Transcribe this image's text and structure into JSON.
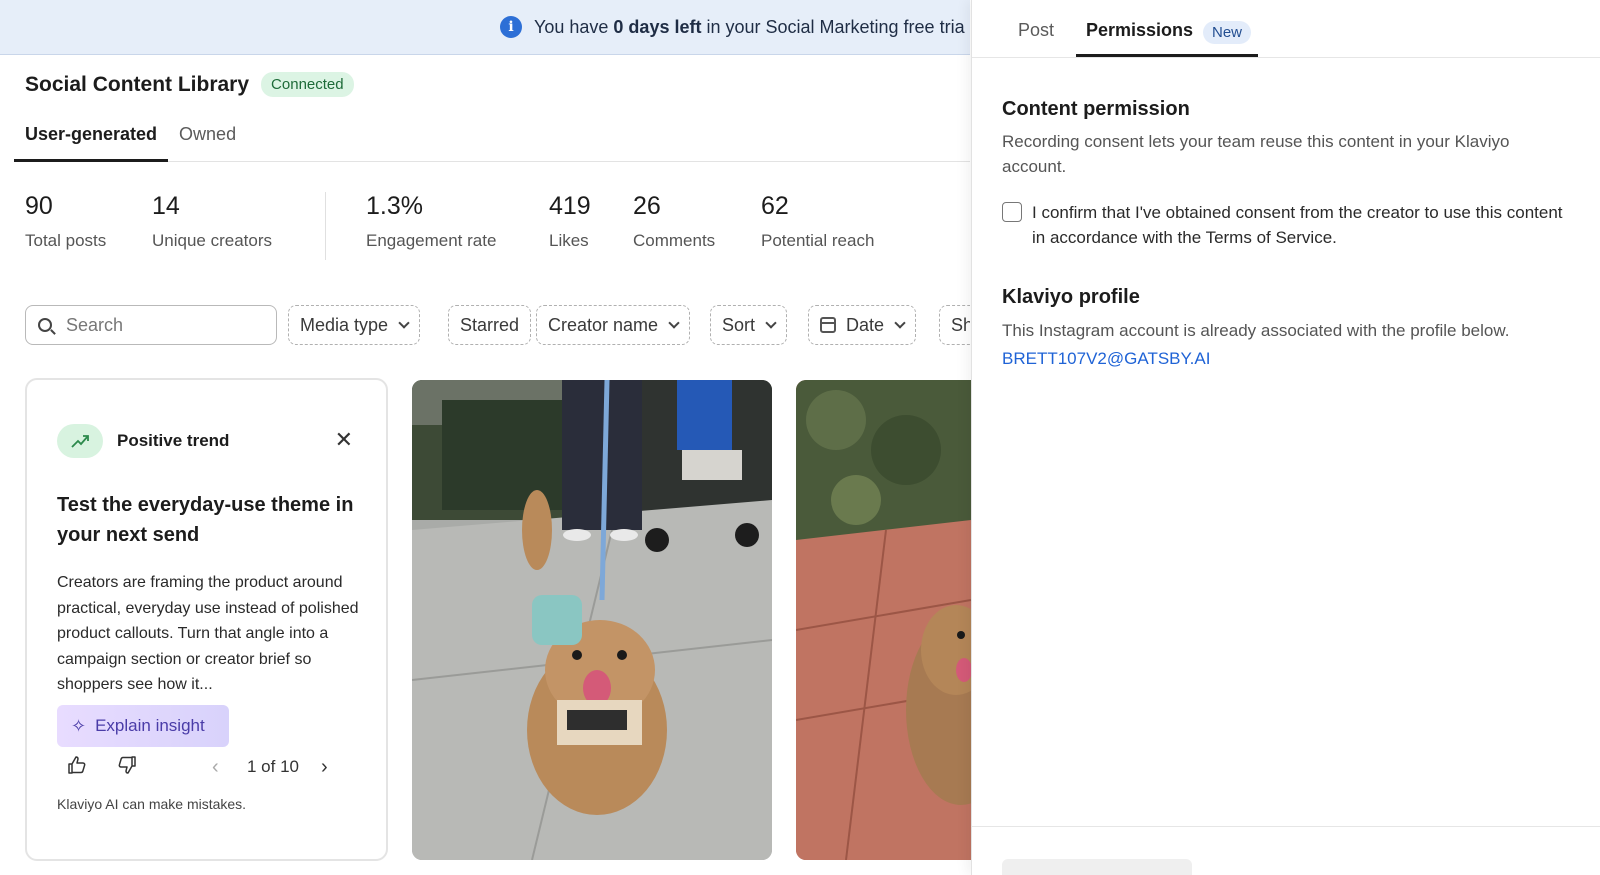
{
  "banner": {
    "prefix": "You have ",
    "bold": "0 days left",
    "suffix": " in your Social Marketing free tria",
    "icon": "info-icon"
  },
  "header": {
    "title": "Social Content Library",
    "badge": "Connected"
  },
  "tabs": [
    {
      "label": "User-generated",
      "active": true
    },
    {
      "label": "Owned",
      "active": false
    }
  ],
  "stats": [
    {
      "value": "90",
      "label": "Total posts"
    },
    {
      "value": "14",
      "label": "Unique creators"
    },
    {
      "value": "1.3%",
      "label": "Engagement rate"
    },
    {
      "value": "419",
      "label": "Likes"
    },
    {
      "value": "26",
      "label": "Comments"
    },
    {
      "value": "62",
      "label": "Potential reach"
    }
  ],
  "filters": {
    "search_placeholder": "Search",
    "chips": [
      "Media type",
      "Starred",
      "Creator name",
      "Sort",
      "Date",
      "Sh"
    ]
  },
  "insight": {
    "trend_label": "Positive trend",
    "title": "Test the everyday-use theme in your next send",
    "body": "Creators are framing the product around practical, everyday use instead of polished product callouts. Turn that angle into a campaign section or creator brief so shoppers see how it...",
    "button": "Explain insight",
    "pager": "1 of 10",
    "note": "Klaviyo AI can make mistakes."
  },
  "panel": {
    "tabs": [
      "Post",
      "Permissions"
    ],
    "new_badge": "New",
    "content_permission": {
      "title": "Content permission",
      "text": "Recording consent lets your team reuse this content in your Klaviyo account.",
      "checkbox_label": "I confirm that I've obtained consent from the creator to use this content in accordance with the Terms of Service.",
      "checked": false
    },
    "profile": {
      "title": "Klaviyo profile",
      "text": "This Instagram account is already associated with the profile below.",
      "email": "BRETT107V2@GATSBY.AI"
    }
  },
  "colors": {
    "banner_bg": "#e6eef9",
    "accent_blue": "#1f63d6",
    "connected_bg": "#dcf4e4",
    "explain_purple": "#4a3ca8"
  }
}
